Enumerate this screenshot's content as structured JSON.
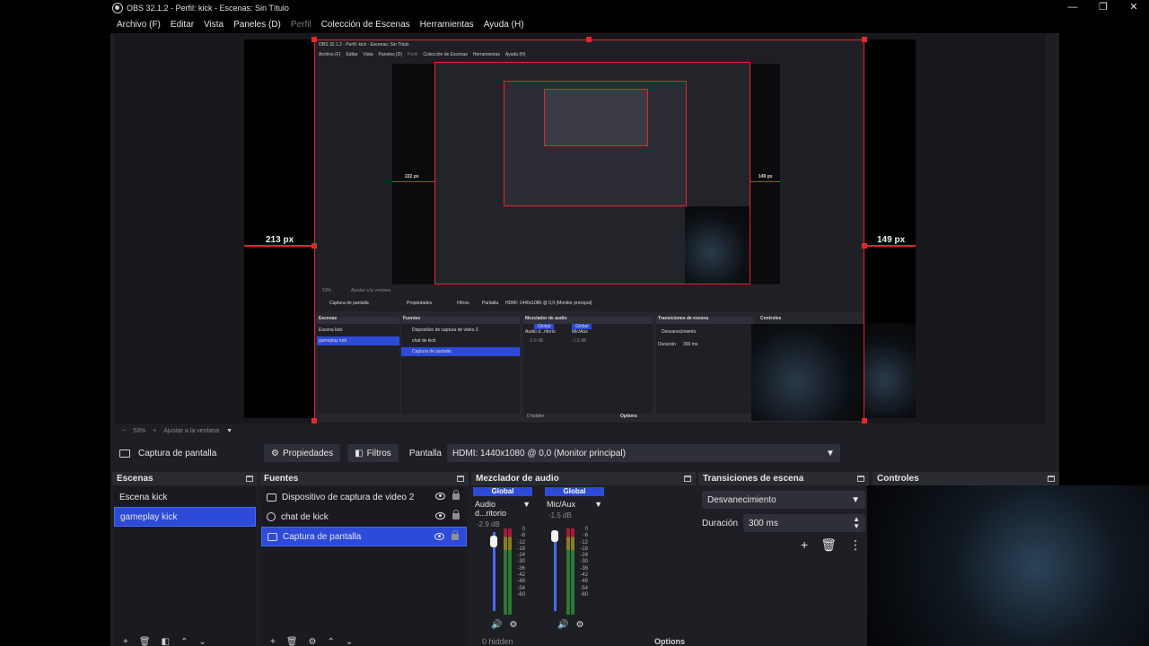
{
  "window": {
    "title": "OBS 32.1.2 - Perfil: kick - Escenas: Sin Título",
    "controls": {
      "minimize": "—",
      "maximize": "❐",
      "close": "✕"
    }
  },
  "menu": {
    "items": [
      {
        "label": "Archivo (F)"
      },
      {
        "label": "Editar"
      },
      {
        "label": "Vista"
      },
      {
        "label": "Paneles (D)"
      },
      {
        "label": "Perfil",
        "disabled": true
      },
      {
        "label": "Colección de Escenas"
      },
      {
        "label": "Herramientas"
      },
      {
        "label": "Ayuda (H)"
      }
    ]
  },
  "preview": {
    "left_distance": "213 px",
    "right_distance": "149 px",
    "nested": {
      "title": "OBS 32.1.2 - Perfil: kick - Escenas: Sin Título",
      "menu": [
        "Archivo (F)",
        "Editar",
        "Vista",
        "Paneles (D)",
        "Perfil",
        "Colección de Escenas",
        "Herramientas",
        "Ayuda (H)"
      ],
      "left_distance": "222 px",
      "right_distance": "149 px",
      "source": "Captura de pantalla",
      "properties": "Propiedades",
      "filters": "Filtros",
      "display_label": "Pantalla",
      "display_value": "HDMI: 1440x1080 @ 0,0 (Monitor principal)",
      "scenes_title": "Escenas",
      "scenes": [
        "Escena kick",
        "gameplay kick"
      ],
      "sources_title": "Fuentes",
      "sources": [
        "Dispositivo de captura de video 2",
        "chat de kick",
        "Captura de pantalla"
      ],
      "mixer_title": "Mezclador de audio",
      "transitions_title": "Transiciones de escena",
      "transition_value": "Desvanecimiento",
      "duration_label": "Duración",
      "duration_value": "300 ms",
      "controls_title": "Controles",
      "zoom": "53%",
      "fit": "Ajustar a la ventana",
      "hidden": "0 hidden",
      "options": "Options",
      "ch1_name": "Audio d...ritorio",
      "ch2_name": "Mic/Aux",
      "global": "Global",
      "ch1_db": "-2.9 dB",
      "ch2_db": "-1.5 dB"
    }
  },
  "zoombar": {
    "minus": "−",
    "zoom": "53%",
    "plus": "+",
    "fit": "Ajustar a la ventana"
  },
  "context": {
    "source_name": "Captura de pantalla",
    "properties": "Propiedades",
    "filters": "Filtros",
    "display_label": "Pantalla",
    "display_value": "HDMI: 1440x1080 @ 0,0 (Monitor principal)"
  },
  "scenes": {
    "title": "Escenas",
    "items": [
      {
        "label": "Escena kick"
      },
      {
        "label": "gameplay kick",
        "selected": true
      }
    ]
  },
  "sources": {
    "title": "Fuentes",
    "items": [
      {
        "label": "Dispositivo de captura de video 2",
        "icon": "camera-icon"
      },
      {
        "label": "chat de kick",
        "icon": "globe-icon"
      },
      {
        "label": "Captura de pantalla",
        "icon": "monitor-icon",
        "selected": true
      }
    ]
  },
  "mixer": {
    "title": "Mezclador de audio",
    "channels": [
      {
        "global": "Global",
        "name": "Audio d...ritorio",
        "db": "-2.9 dB"
      },
      {
        "global": "Global",
        "name": "Mic/Aux",
        "db": "-1.5 dB"
      }
    ],
    "scale": [
      "0",
      "-6",
      "-12",
      "-18",
      "-24",
      "-30",
      "-36",
      "-42",
      "-48",
      "-54",
      "-60"
    ],
    "footer": {
      "hidden": "0 hidden",
      "options": "Options"
    }
  },
  "transitions": {
    "title": "Transiciones de escena",
    "selected": "Desvanecimiento",
    "duration_label": "Duración",
    "duration_value": "300 ms"
  },
  "controls": {
    "title": "Controles"
  },
  "colors": {
    "accent": "#2d4ad8",
    "guide": "#e6262e",
    "panel": "#1e1f24"
  }
}
